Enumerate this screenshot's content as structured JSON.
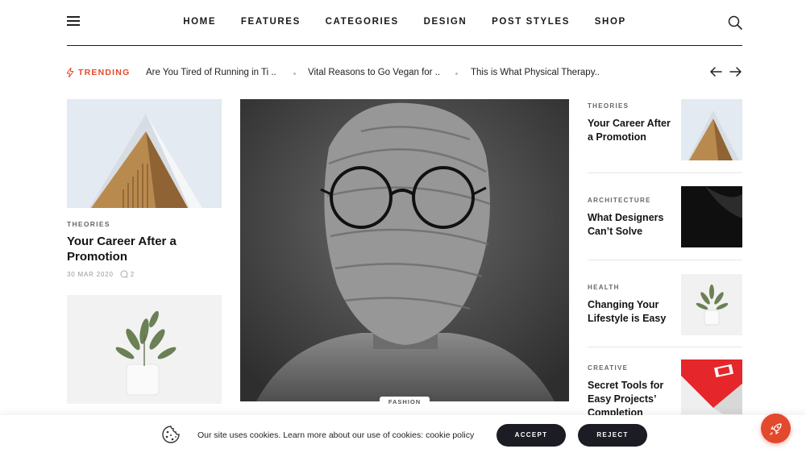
{
  "nav": {
    "items": [
      "HOME",
      "FEATURES",
      "CATEGORIES",
      "DESIGN",
      "POST STYLES",
      "SHOP"
    ]
  },
  "trending": {
    "label": "TRENDING",
    "items": [
      "Are You Tired of Running in Ti ..",
      "Vital Reasons to Go Vegan for ..",
      "This is What Physical Therapy.."
    ]
  },
  "left": {
    "post1": {
      "category": "THEORIES",
      "title": "Your Career After a Promotion",
      "date": "30 MAR 2020",
      "comments": "2"
    }
  },
  "hero": {
    "badge": "FASHION"
  },
  "side": [
    {
      "category": "THEORIES",
      "title": "Your Career After a Promotion"
    },
    {
      "category": "ARCHITECTURE",
      "title": "What Designers Can’t Solve"
    },
    {
      "category": "HEALTH",
      "title": "Changing Your Lifestyle is Easy"
    },
    {
      "category": "CREATIVE",
      "title": "Secret Tools for Easy Projects’ Completion"
    }
  ],
  "cookie": {
    "text": "Our site uses cookies. Learn more about our use of cookies: ",
    "link": "cookie policy",
    "accept": "ACCEPT",
    "reject": "REJECT"
  },
  "colors": {
    "accent": "#e2492d",
    "dark_button": "#1c1c24"
  }
}
